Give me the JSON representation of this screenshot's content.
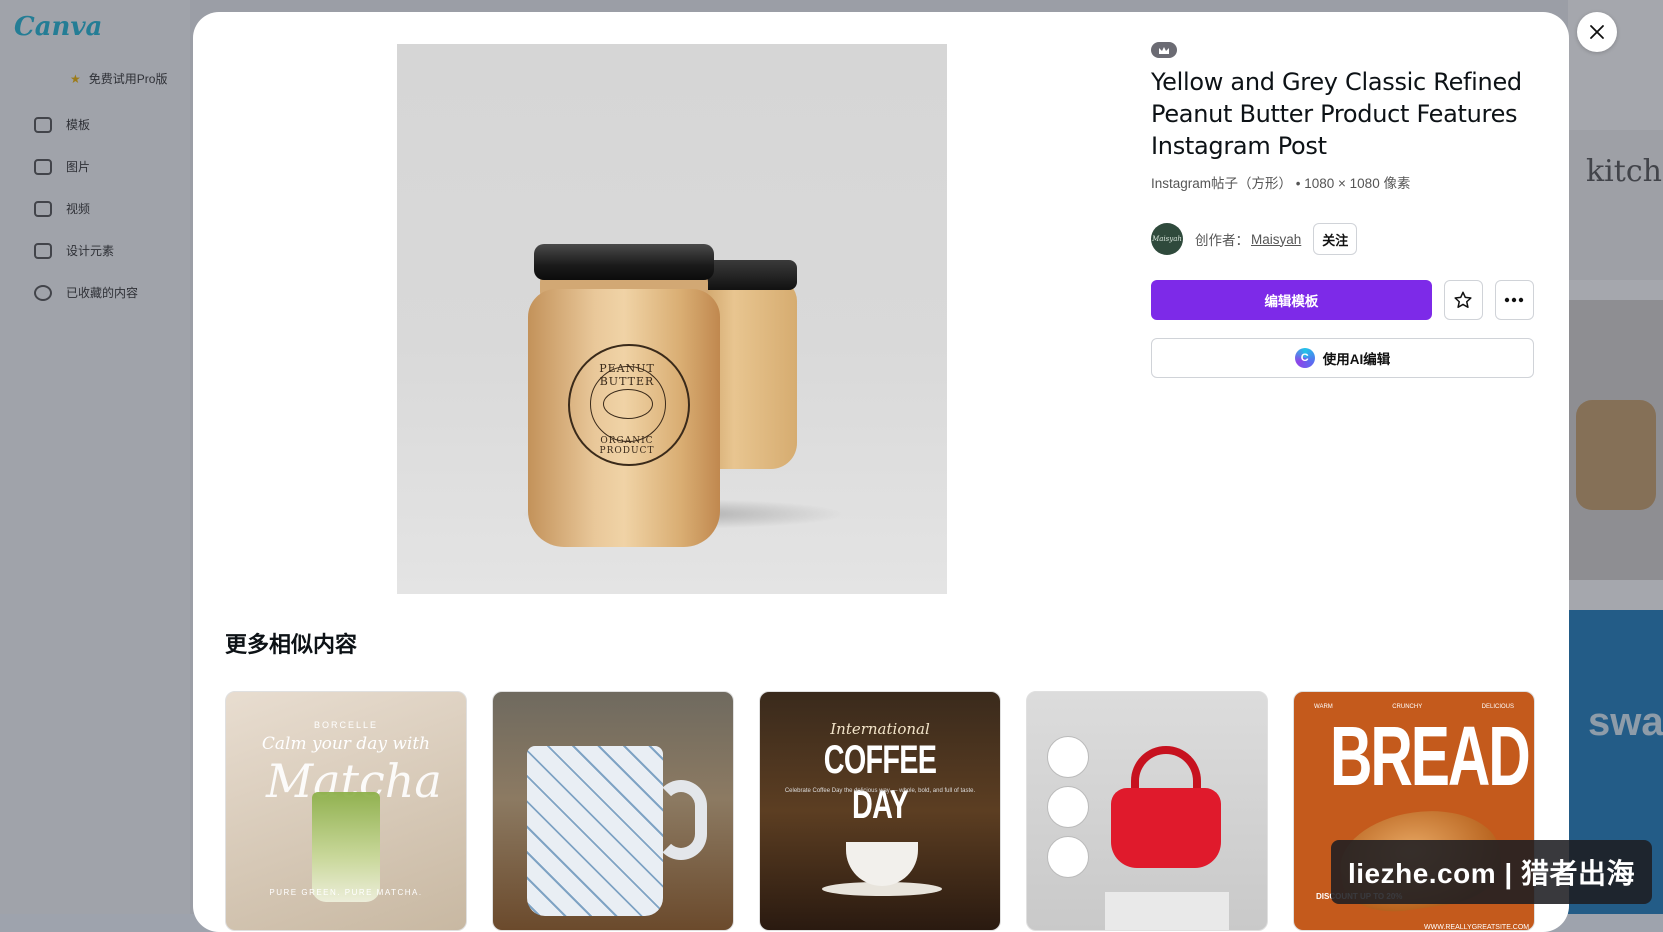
{
  "background": {
    "logo": "Canva",
    "upgrade_label": "免费试用Pro版",
    "nav_items": [
      {
        "label": "模板",
        "icon": "template-icon"
      },
      {
        "label": "图片",
        "icon": "photo-icon"
      },
      {
        "label": "视频",
        "icon": "video-icon"
      },
      {
        "label": "设计元素",
        "icon": "elements-icon"
      },
      {
        "label": "已收藏的内容",
        "icon": "star-icon"
      }
    ],
    "right_peek_text": "kitche",
    "right_peek_text2": "swar"
  },
  "modal": {
    "close_icon": "close-icon",
    "preview": {
      "label_top": "PEANUT BUTTER",
      "label_bottom": "ORGANIC PRODUCT"
    },
    "pro_badge_icon": "crown-icon",
    "title": "Yellow and Grey Classic Refined Peanut Butter Product Features Instagram Post",
    "meta": "Instagram帖子（方形） • 1080 × 1080 像素",
    "author": {
      "avatar_text": "Maisyah",
      "prefix": "创作者：",
      "name": "Maisyah",
      "follow_label": "关注"
    },
    "actions": {
      "edit_label": "编辑模板",
      "favorite_icon": "star-outline-icon",
      "more_icon": "more-dots-icon",
      "ai_label": "使用AI编辑",
      "ai_icon": "canva-ai-icon"
    },
    "accent_color": "#7d2ae8",
    "similar": {
      "title": "更多相似内容",
      "items": [
        {
          "brand": "BORCELLE",
          "script": "Calm your day with",
          "big": "Matcha",
          "footer": "PURE GREEN. PURE MATCHA."
        },
        {
          "name": "patterned-mug"
        },
        {
          "script": "International",
          "big": "COFFEE DAY",
          "small": "Celebrate Coffee Day the delicious way — whole, bold, and full of taste."
        },
        {
          "name": "red-handbag"
        },
        {
          "tops": [
            "WARM",
            "CRUNCHY",
            "DELICIOUS"
          ],
          "big": "BREAD",
          "discount": "DISCOUNT UP TO 20%",
          "url": "WWW.REALLYGREATSITE.COM"
        }
      ]
    }
  },
  "watermark": "liezhe.com | 猎者出海"
}
